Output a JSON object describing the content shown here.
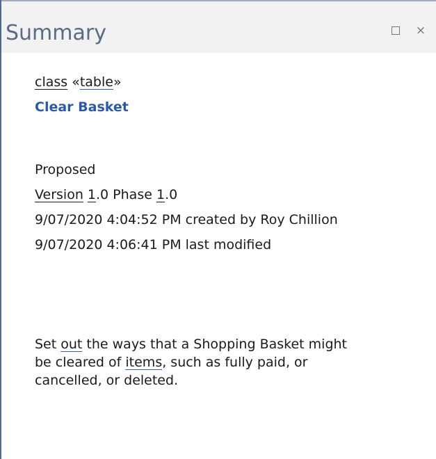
{
  "panel": {
    "title": "Summary",
    "maximize_icon": "maximize-icon",
    "close_icon": "close-icon",
    "close_glyph": "×"
  },
  "element": {
    "type_keyword": "class",
    "stereotype_open": " «",
    "stereotype": "table",
    "stereotype_close": "»",
    "name": "Clear Basket"
  },
  "details": {
    "status": "Proposed",
    "version_label": "Version",
    "version_value_prefix": " ",
    "version_major": "1",
    "version_rest": ".0  Phase ",
    "phase_major": "1",
    "phase_rest": ".0",
    "created_line": "9/07/2020 4:04:52 PM created by Roy Chillion",
    "modified_line": "9/07/2020 4:06:41 PM last modified"
  },
  "description": {
    "l1_a": "Set ",
    "l1_link": "out",
    "l1_b": " the ways that a Shopping Basket might",
    "l2_a": "be cleared of ",
    "l2_link": "items",
    "l2_b": ", such as fully paid, or",
    "l3": "cancelled, or deleted."
  },
  "colors": {
    "title_text": "#5b6b85",
    "element_name": "#2d5aa6",
    "left_border": "#4d6b8f"
  }
}
